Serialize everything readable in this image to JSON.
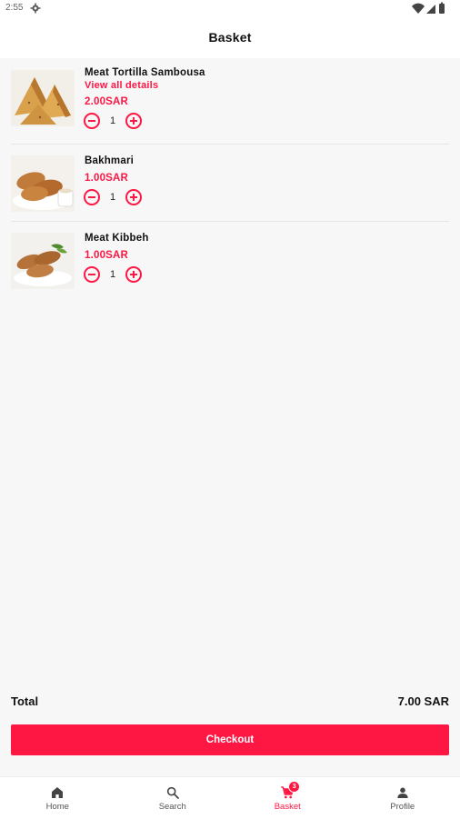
{
  "status_bar": {
    "time": "2:55",
    "icons": [
      "gear-icon",
      "wifi-icon",
      "signal-icon",
      "battery-icon"
    ]
  },
  "header": {
    "title": "Basket"
  },
  "basket": {
    "items": [
      {
        "name": "Meat Tortilla Sambousa",
        "details_link": "View all details",
        "price": "2.00SAR",
        "quantity": "1"
      },
      {
        "name": "Bakhmari",
        "price": "1.00SAR",
        "quantity": "1"
      },
      {
        "name": "Meat Kibbeh",
        "price": "1.00SAR",
        "quantity": "1"
      }
    ]
  },
  "summary": {
    "total_label": "Total",
    "total_value": "7.00 SAR",
    "checkout_label": "Checkout"
  },
  "bottom_nav": {
    "items": [
      {
        "label": "Home",
        "icon": "home-icon"
      },
      {
        "label": "Search",
        "icon": "search-icon"
      },
      {
        "label": "Basket",
        "icon": "cart-icon",
        "badge": "3",
        "active": true
      },
      {
        "label": "Profile",
        "icon": "person-icon"
      }
    ]
  },
  "colors": {
    "accent": "#ff1744",
    "background": "#f7f7f7",
    "text": "#111111"
  }
}
